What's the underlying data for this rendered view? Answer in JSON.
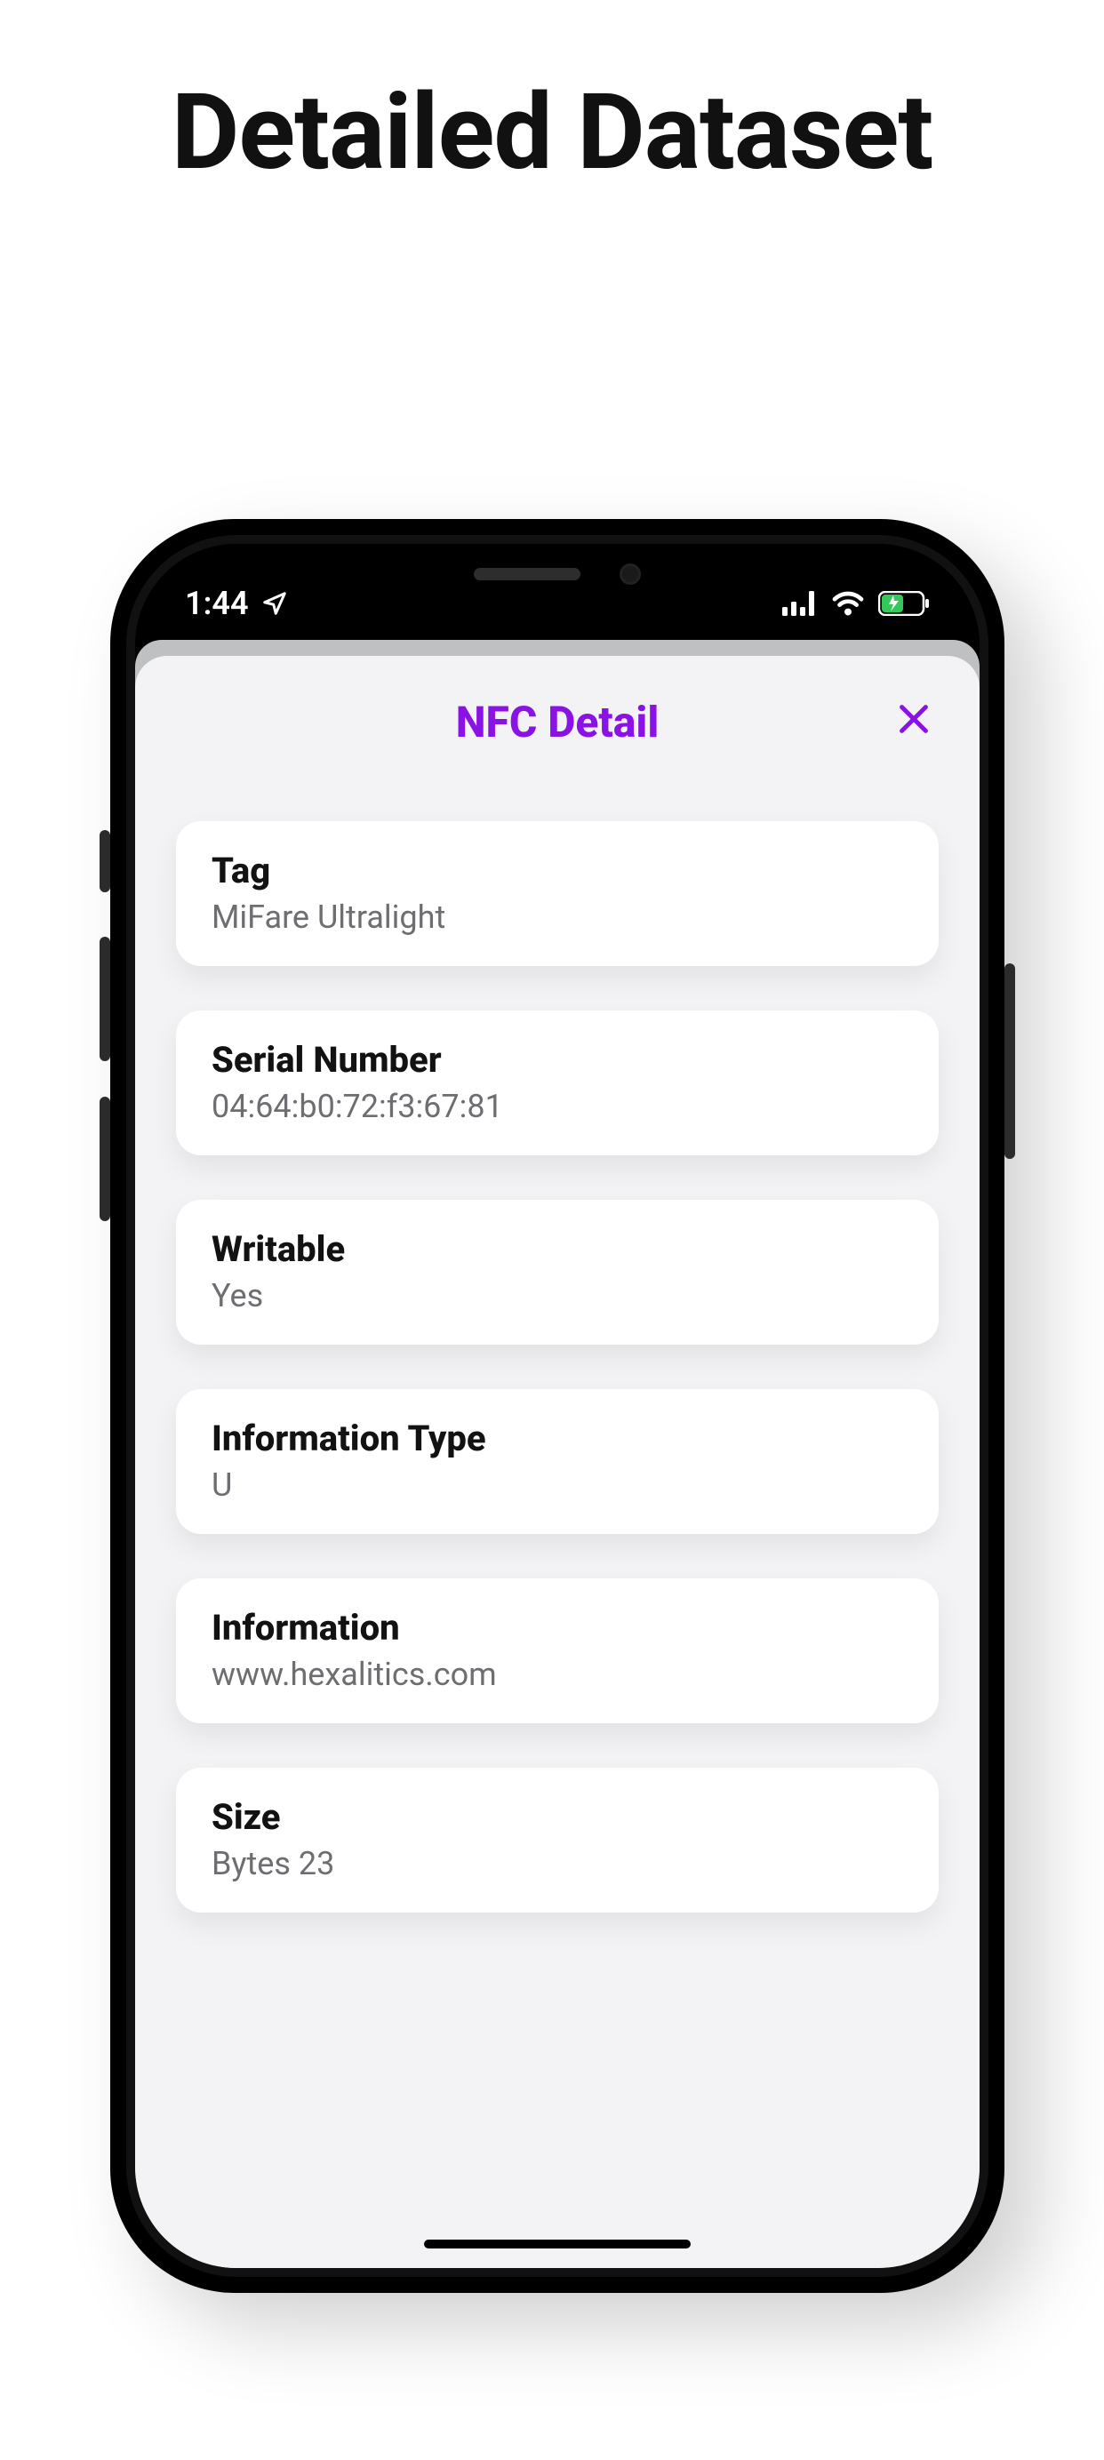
{
  "page": {
    "title": "Detailed Dataset"
  },
  "status_bar": {
    "time": "1:44"
  },
  "sheet": {
    "title": "NFC Detail",
    "cards": [
      {
        "label": "Tag",
        "value": "MiFare Ultralight"
      },
      {
        "label": "Serial Number",
        "value": "04:64:b0:72:f3:67:81"
      },
      {
        "label": "Writable",
        "value": "Yes"
      },
      {
        "label": "Information Type",
        "value": "U"
      },
      {
        "label": "Information",
        "value": "www.hexalitics.com"
      },
      {
        "label": "Size",
        "value": "Bytes 23"
      }
    ]
  },
  "colors": {
    "accent": "#8a12e4"
  }
}
